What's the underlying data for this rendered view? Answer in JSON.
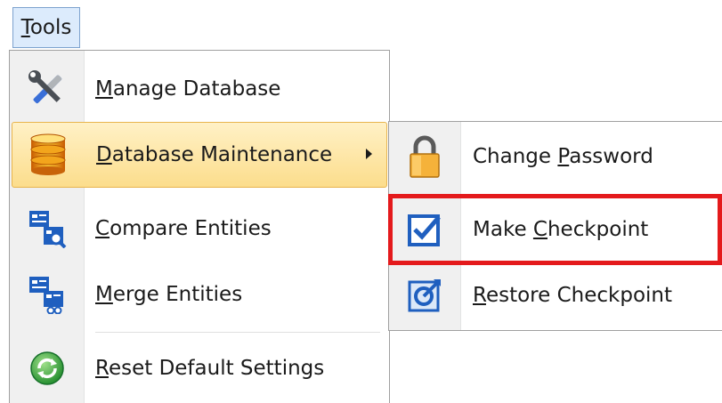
{
  "menubar": {
    "tools": {
      "label_pre": "",
      "label_u": "T",
      "label_post": "ools"
    }
  },
  "tools_menu": {
    "items": [
      {
        "label_u": "M",
        "label_post": "anage Database",
        "icon": "tools-wrench-screwdriver-icon"
      },
      {
        "label_u": "D",
        "label_post": "atabase Maintenance",
        "icon": "database-icon",
        "has_submenu": true,
        "state": "highlighted"
      },
      {
        "label_u": "C",
        "label_post": "ompare Entities",
        "icon": "compare-entities-icon"
      },
      {
        "label_u": "M",
        "label_post": "erge Entities",
        "icon": "merge-entities-icon"
      },
      {
        "label_u": "R",
        "label_post": "eset Default Settings",
        "icon": "reset-settings-icon"
      }
    ]
  },
  "submenu": {
    "items": [
      {
        "label_pre": "Change ",
        "label_u": "P",
        "label_post": "assword",
        "icon": "padlock-icon"
      },
      {
        "label_pre": "Make ",
        "label_u": "C",
        "label_post": "heckpoint",
        "icon": "checkbox-icon"
      },
      {
        "label_pre": "",
        "label_u": "R",
        "label_post": "estore Checkpoint",
        "icon": "restore-checkpoint-icon"
      }
    ]
  },
  "colors": {
    "highlight_box": "#e41a1c",
    "hot_item_top": "#fff1c6",
    "hot_item_bottom": "#fcdd8c"
  }
}
